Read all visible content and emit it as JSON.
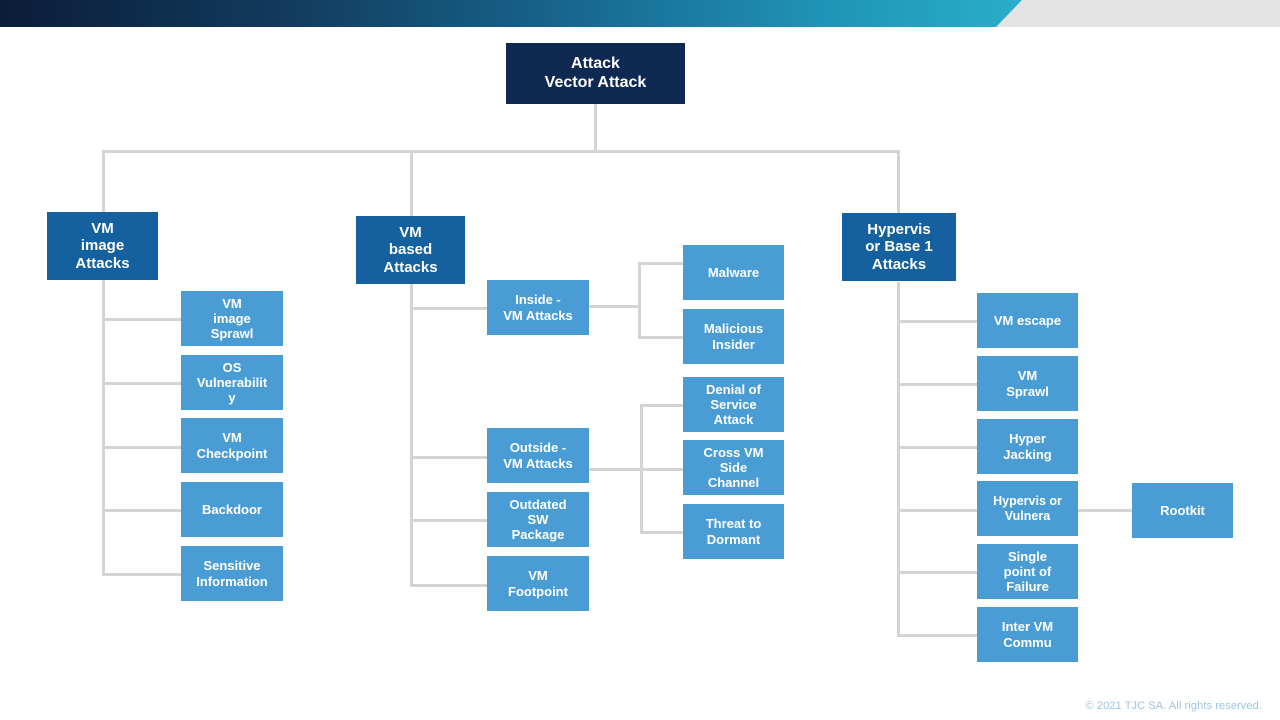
{
  "header": {
    "band_gradient_from": "#0b1d38",
    "band_gradient_to": "#2aaec8",
    "band_background": "#e3e3e3"
  },
  "footer": {
    "copyright": "© 2021 TJC SA. All rights reserved."
  },
  "colors": {
    "root_box": "#0e2a52",
    "level1_box": "#15609e",
    "leaf_box": "#4a9dd4",
    "connector": "#d4d4d4",
    "text": "#ffffff",
    "footer_text": "#9cc3e4"
  },
  "diagram": {
    "type": "tree",
    "root": {
      "label": "Attack\nVector Attack"
    },
    "branches": [
      {
        "label": "VM\nimage\nAttacks",
        "children": [
          {
            "label": "VM\nimage\nSprawl"
          },
          {
            "label": "OS\nVulnerabilit\ny"
          },
          {
            "label": "VM\nCheckpoint"
          },
          {
            "label": "Backdoor"
          },
          {
            "label": "Sensitive\nInformation"
          }
        ]
      },
      {
        "label": "VM\nbased\nAttacks",
        "children": [
          {
            "label": "Inside -\nVM Attacks",
            "children": [
              {
                "label": "Malware"
              },
              {
                "label": "Malicious\nInsider"
              }
            ]
          },
          {
            "label": "Outside -\nVM Attacks",
            "children": [
              {
                "label": "Denial of\nService\nAttack"
              },
              {
                "label": "Cross VM\nSide\nChannel"
              },
              {
                "label": "Threat to\nDormant"
              }
            ]
          },
          {
            "label": "Outdated\nSW\nPackage"
          },
          {
            "label": "VM\nFootpoint"
          }
        ]
      },
      {
        "label": "Hypervis\nor Base 1\nAttacks",
        "children": [
          {
            "label": "VM escape"
          },
          {
            "label": "VM\nSprawl"
          },
          {
            "label": "Hyper\nJacking"
          },
          {
            "label": "Hypervis or\nVulnera",
            "children": [
              {
                "label": "Rootkit"
              }
            ]
          },
          {
            "label": "Single\npoint of\nFailure"
          },
          {
            "label": "Inter VM\nCommu"
          }
        ]
      }
    ]
  }
}
